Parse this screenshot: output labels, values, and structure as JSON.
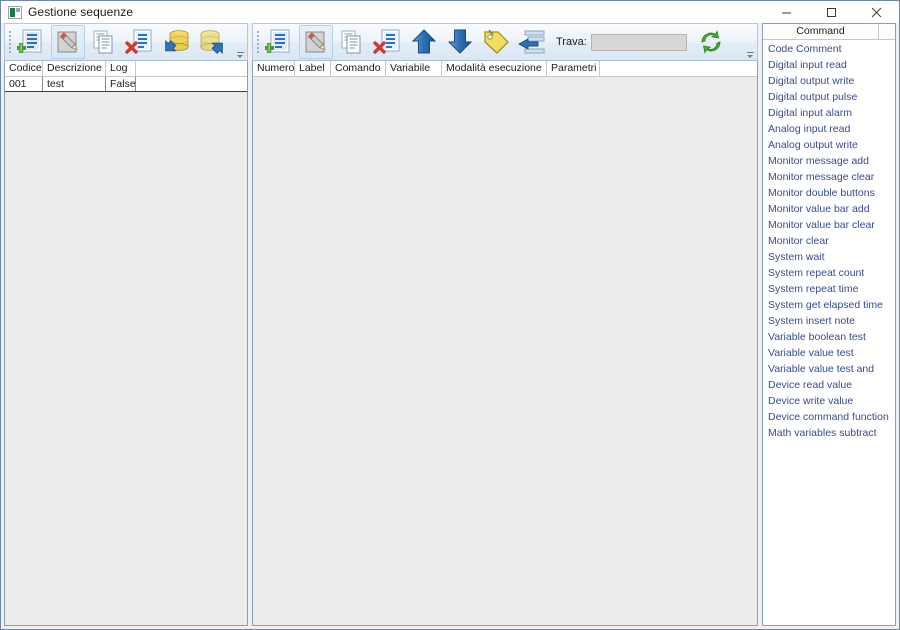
{
  "window": {
    "title": "Gestione sequenze",
    "icon": "app-window-icon",
    "minimize_label": "–",
    "maximize_label": "□",
    "close_label": "×"
  },
  "left_toolbar": {
    "buttons": [
      {
        "name": "new-sequence-button",
        "icon": "document-add-icon",
        "tooltip": "Nuovo"
      },
      {
        "name": "edit-sequence-button",
        "icon": "document-edit-icon",
        "tooltip": "Modifica"
      },
      {
        "name": "copy-sequence-button",
        "icon": "document-copy-icon",
        "tooltip": "Copia"
      },
      {
        "name": "delete-sequence-button",
        "icon": "document-delete-icon",
        "tooltip": "Elimina"
      },
      {
        "name": "load-db-button",
        "icon": "database-import-icon",
        "tooltip": "Carica"
      },
      {
        "name": "save-db-button",
        "icon": "database-export-icon",
        "tooltip": "Salva"
      }
    ],
    "overflow_icon": "toolbar-overflow-chevron-icon"
  },
  "mid_toolbar": {
    "buttons": [
      {
        "name": "new-step-button",
        "icon": "document-add-icon",
        "tooltip": "Nuovo passo"
      },
      {
        "name": "edit-step-button",
        "icon": "document-edit-icon",
        "tooltip": "Modifica passo"
      },
      {
        "name": "copy-step-button",
        "icon": "document-copy-icon",
        "tooltip": "Copia passo"
      },
      {
        "name": "delete-step-button",
        "icon": "document-delete-icon",
        "tooltip": "Elimina passo"
      },
      {
        "name": "move-up-button",
        "icon": "arrow-up-icon",
        "tooltip": "Sposta su"
      },
      {
        "name": "move-down-button",
        "icon": "arrow-down-icon",
        "tooltip": "Sposta giù"
      },
      {
        "name": "label-button",
        "icon": "tag-icon",
        "tooltip": "Etichetta"
      },
      {
        "name": "goto-label-button",
        "icon": "jump-to-icon",
        "tooltip": "Vai a"
      }
    ],
    "field_label": "Trava:",
    "field_value": "",
    "field_placeholder": "",
    "refresh_button": {
      "name": "refresh-button",
      "icon": "refresh-icon"
    },
    "overflow_icon": "toolbar-overflow-chevron-icon"
  },
  "sequences_grid": {
    "columns": [
      "Codice",
      "Descrizione",
      "Log"
    ],
    "rows": [
      {
        "codice": "001",
        "descrizione": "test",
        "log": "False"
      }
    ]
  },
  "steps_grid": {
    "columns": [
      "Numero",
      "Label",
      "Comando",
      "Variabile",
      "Modalità esecuzione",
      "Parametri"
    ],
    "rows": []
  },
  "command_panel": {
    "header": "Command",
    "items": [
      "Code Comment",
      "Digital input read",
      "Digital output write",
      "Digital output pulse",
      "Digital input alarm",
      "Analog input read",
      "Analog output write",
      "Monitor message add",
      "Monitor message clear",
      "Monitor double buttons",
      "Monitor value bar add",
      "Monitor value bar clear",
      "Monitor  clear",
      "System wait",
      "System repeat count",
      "System repeat time",
      "System get elapsed time",
      "System insert note",
      "Variable boolean test",
      "Variable value test",
      "Variable value test and",
      "Device read value",
      "Device write value",
      "Device command function",
      "Math variables subtract"
    ]
  },
  "colors": {
    "window_border": "#6e87a8",
    "toolbar_bg": "#e6eff8",
    "grid_empty_bg": "#ececec",
    "command_text": "#3b4a8c",
    "accent_green": "#4a9b34",
    "accent_blue": "#2f72b8",
    "accent_yellow": "#e8c832",
    "accent_red": "#cc3b32"
  }
}
